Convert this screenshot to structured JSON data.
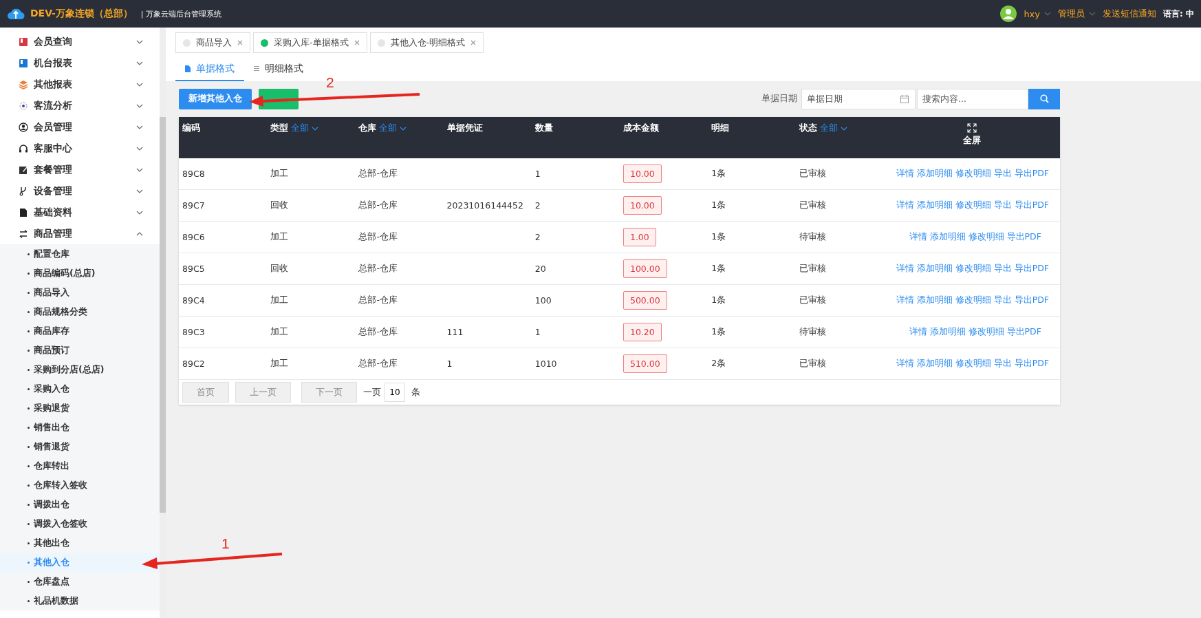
{
  "header": {
    "brand": "DEV-万象连锁（总部）",
    "system": "| 万象云端后台管理系统",
    "user": "hxy",
    "role": "管理员",
    "notify": "发送短信通知",
    "language": "语言: 中"
  },
  "sidebar": {
    "items": [
      {
        "label": "会员查询",
        "expanded": false
      },
      {
        "label": "机台报表",
        "expanded": false
      },
      {
        "label": "其他报表",
        "expanded": false
      },
      {
        "label": "客流分析",
        "expanded": false
      },
      {
        "label": "会员管理",
        "expanded": false
      },
      {
        "label": "客服中心",
        "expanded": false
      },
      {
        "label": "套餐管理",
        "expanded": false
      },
      {
        "label": "设备管理",
        "expanded": false
      },
      {
        "label": "基础资料",
        "expanded": false
      },
      {
        "label": "商品管理",
        "expanded": true,
        "children": [
          {
            "label": "配置仓库",
            "selected": false
          },
          {
            "label": "商品编码(总店)",
            "selected": false
          },
          {
            "label": "商品导入",
            "selected": false
          },
          {
            "label": "商品规格分类",
            "selected": false
          },
          {
            "label": "商品库存",
            "selected": false
          },
          {
            "label": "商品预订",
            "selected": false
          },
          {
            "label": "采购到分店(总店)",
            "selected": false
          },
          {
            "label": "采购入仓",
            "selected": false
          },
          {
            "label": "采购退货",
            "selected": false
          },
          {
            "label": "销售出仓",
            "selected": false
          },
          {
            "label": "销售退货",
            "selected": false
          },
          {
            "label": "仓库转出",
            "selected": false
          },
          {
            "label": "仓库转入签收",
            "selected": false
          },
          {
            "label": "调拨出仓",
            "selected": false
          },
          {
            "label": "调拨入仓签收",
            "selected": false
          },
          {
            "label": "其他出仓",
            "selected": false
          },
          {
            "label": "其他入仓",
            "selected": true
          },
          {
            "label": "仓库盘点",
            "selected": false
          },
          {
            "label": "礼品机数据",
            "selected": false
          }
        ]
      }
    ]
  },
  "page_tabs": [
    {
      "label": "商品导入",
      "selected": false
    },
    {
      "label": "采购入库-单据格式",
      "selected": true
    },
    {
      "label": "其他入仓-明细格式",
      "selected": false
    }
  ],
  "view_tabs": [
    {
      "label": "单据格式",
      "selected": true
    },
    {
      "label": "明细格式",
      "selected": false
    }
  ],
  "toolbar": {
    "add_button": "新增其他入仓",
    "date_label": "单据日期",
    "date_placeholder": "单据日期",
    "search_placeholder": "搜索内容..."
  },
  "table": {
    "columns": [
      {
        "label": "编码"
      },
      {
        "label": "类型",
        "filter": "全部"
      },
      {
        "label": "仓库",
        "filter": "全部"
      },
      {
        "label": "单据凭证"
      },
      {
        "label": "数量"
      },
      {
        "label": "成本金额"
      },
      {
        "label": "明细"
      },
      {
        "label": "状态",
        "filter": "全部"
      },
      {
        "label": "全屏"
      }
    ],
    "rows": [
      {
        "code": "89C8",
        "type": "加工",
        "warehouse": "总部-仓库",
        "voucher": "",
        "qty": "1",
        "cost": "10.00",
        "detail": "1条",
        "status": "已审核",
        "actions": [
          "详情",
          "添加明细",
          "修改明细",
          "导出",
          "导出PDF"
        ]
      },
      {
        "code": "89C7",
        "type": "回收",
        "warehouse": "总部-仓库",
        "voucher": "20231016144452",
        "qty": "2",
        "cost": "10.00",
        "detail": "1条",
        "status": "已审核",
        "actions": [
          "详情",
          "添加明细",
          "修改明细",
          "导出",
          "导出PDF"
        ]
      },
      {
        "code": "89C6",
        "type": "加工",
        "warehouse": "总部-仓库",
        "voucher": "",
        "qty": "2",
        "cost": "1.00",
        "detail": "1条",
        "status": "待审核",
        "actions": [
          "详情",
          "添加明细",
          "修改明细",
          "导出PDF"
        ]
      },
      {
        "code": "89C5",
        "type": "回收",
        "warehouse": "总部-仓库",
        "voucher": "",
        "qty": "20",
        "cost": "100.00",
        "detail": "1条",
        "status": "已审核",
        "actions": [
          "详情",
          "添加明细",
          "修改明细",
          "导出",
          "导出PDF"
        ]
      },
      {
        "code": "89C4",
        "type": "加工",
        "warehouse": "总部-仓库",
        "voucher": "",
        "qty": "100",
        "cost": "500.00",
        "detail": "1条",
        "status": "已审核",
        "actions": [
          "详情",
          "添加明细",
          "修改明细",
          "导出",
          "导出PDF"
        ]
      },
      {
        "code": "89C3",
        "type": "加工",
        "warehouse": "总部-仓库",
        "voucher": "111",
        "qty": "1",
        "cost": "10.20",
        "detail": "1条",
        "status": "待审核",
        "actions": [
          "详情",
          "添加明细",
          "修改明细",
          "导出PDF"
        ]
      },
      {
        "code": "89C2",
        "type": "加工",
        "warehouse": "总部-仓库",
        "voucher": "1",
        "qty": "1010",
        "cost": "510.00",
        "detail": "2条",
        "status": "已审核",
        "actions": [
          "详情",
          "添加明细",
          "修改明细",
          "导出",
          "导出PDF"
        ]
      }
    ]
  },
  "pagination": {
    "buttons": [
      {
        "label": "首页",
        "disabled": true
      },
      {
        "label": "上一页",
        "disabled": true
      },
      {
        "label": "下一页",
        "disabled": true
      }
    ],
    "per_page_label": "一页",
    "per_page": "10",
    "unit": "条"
  },
  "annotations": [
    {
      "label": "1"
    },
    {
      "label": "2"
    }
  ]
}
